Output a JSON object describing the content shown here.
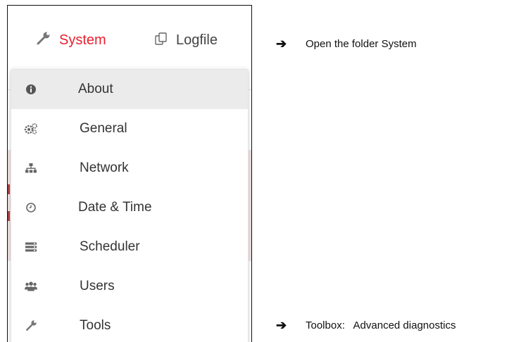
{
  "top_nav": {
    "system_label": "System",
    "logfiles_label": "Logfile",
    "system_icon": "wrench-icon",
    "logfiles_icon": "files-icon"
  },
  "dropdown": {
    "items": [
      {
        "label": "About",
        "icon": "info-circle-icon",
        "active": true
      },
      {
        "label": "General",
        "icon": "cogs-icon"
      },
      {
        "label": "Network",
        "icon": "sitemap-icon"
      },
      {
        "label": "Date & Time",
        "icon": "clock-icon"
      },
      {
        "label": "Scheduler",
        "icon": "server-icon"
      },
      {
        "label": "Users",
        "icon": "users-icon"
      },
      {
        "label": "Tools",
        "icon": "wrench-icon"
      }
    ]
  },
  "annotations": [
    {
      "arrow": "➔",
      "text": "Open the folder System"
    },
    {
      "arrow": "➔",
      "text": "Toolbox:   Advanced diagnostics"
    }
  ],
  "colors": {
    "accent": "#e8202e",
    "active_bg": "#ebebeb",
    "icon_gray": "#666666"
  }
}
